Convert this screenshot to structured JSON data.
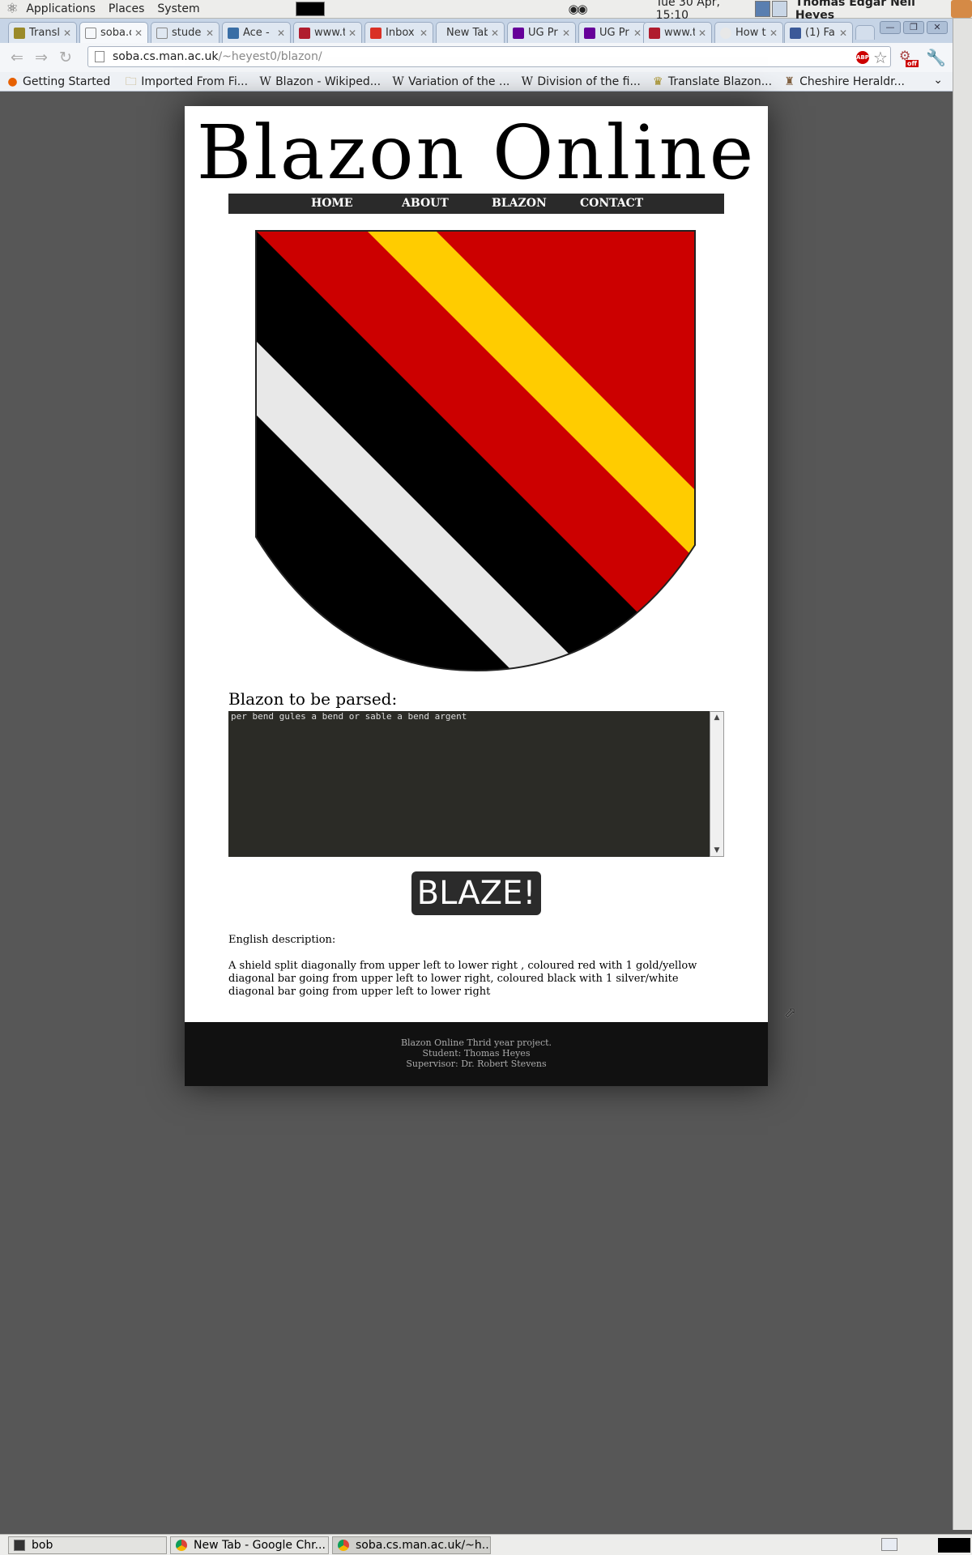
{
  "top_panel": {
    "menus": [
      "Applications",
      "Places",
      "System"
    ],
    "clock": "Tue 30 Apr, 15:10",
    "user": "Thomas Edgar Neil Heyes"
  },
  "tabs": [
    {
      "label": "Transl",
      "icon": "lion-favicon-icon",
      "color": "#9a8a2a"
    },
    {
      "label": "soba.c",
      "icon": "page-icon",
      "color": "#ffffff",
      "active": true
    },
    {
      "label": "stude",
      "icon": "page-icon",
      "color": "#ffffff"
    },
    {
      "label": "Ace -",
      "icon": "cloud-icon",
      "color": "#3a6ea5"
    },
    {
      "label": "www.t",
      "icon": "flag-icon",
      "color": "#b01c2e"
    },
    {
      "label": "Inbox",
      "icon": "gmail-icon",
      "color": "#d93025"
    },
    {
      "label": "New Tab",
      "icon": "",
      "color": ""
    },
    {
      "label": "UG Pr",
      "icon": "manchester-icon",
      "color": "#660099"
    },
    {
      "label": "UG Pr",
      "icon": "manchester-icon",
      "color": "#660099"
    },
    {
      "label": "www.t",
      "icon": "flag-icon",
      "color": "#b01c2e"
    },
    {
      "label": "How t",
      "icon": "face-icon",
      "color": "#e8e8e8"
    },
    {
      "label": "(1) Fa",
      "icon": "facebook-icon",
      "color": "#3b5998"
    }
  ],
  "address_bar": {
    "host": "soba.cs.man.ac.uk",
    "path": "/~heyest0/blazon/"
  },
  "bookmarks": [
    {
      "label": "Getting Started",
      "icon": "firefox-icon"
    },
    {
      "label": "Imported From Fi...",
      "icon": "folder-icon"
    },
    {
      "label": "Blazon - Wikiped...",
      "icon": "wikipedia-icon"
    },
    {
      "label": "Variation of the ...",
      "icon": "wikipedia-icon"
    },
    {
      "label": "Division of the fi...",
      "icon": "wikipedia-icon"
    },
    {
      "label": "Translate Blazon...",
      "icon": "lion-icon"
    },
    {
      "label": "Cheshire Heraldr...",
      "icon": "crest-icon"
    }
  ],
  "page": {
    "title": "Blazon Online",
    "nav": [
      "HOME",
      "ABOUT",
      "BLAZON",
      "CONTACT"
    ],
    "shield_colors": {
      "gules": "#cc0000",
      "or": "#ffcc00",
      "sable": "#000000",
      "argent": "#e8e8e8"
    },
    "blazon_label": "Blazon to be parsed:",
    "blazon_value": "per bend gules a bend or sable a bend argent",
    "blaze_button": "BLAZE!",
    "description_heading": "English description:",
    "description": "A shield split diagonally from upper left to lower right , coloured red with 1 gold/yellow diagonal bar going from upper left to lower right, coloured black with 1 silver/white diagonal bar going from upper left to lower right",
    "footer": [
      "Blazon Online Thrid year project.",
      "Student: Thomas Heyes",
      "Supervisor: Dr. Robert Stevens"
    ]
  },
  "taskbar": [
    {
      "label": "bob",
      "icon": "terminal-icon"
    },
    {
      "label": "New Tab - Google Chr...",
      "icon": "chrome-icon"
    },
    {
      "label": "soba.cs.man.ac.uk/~h...",
      "icon": "chrome-icon",
      "active": true
    }
  ]
}
